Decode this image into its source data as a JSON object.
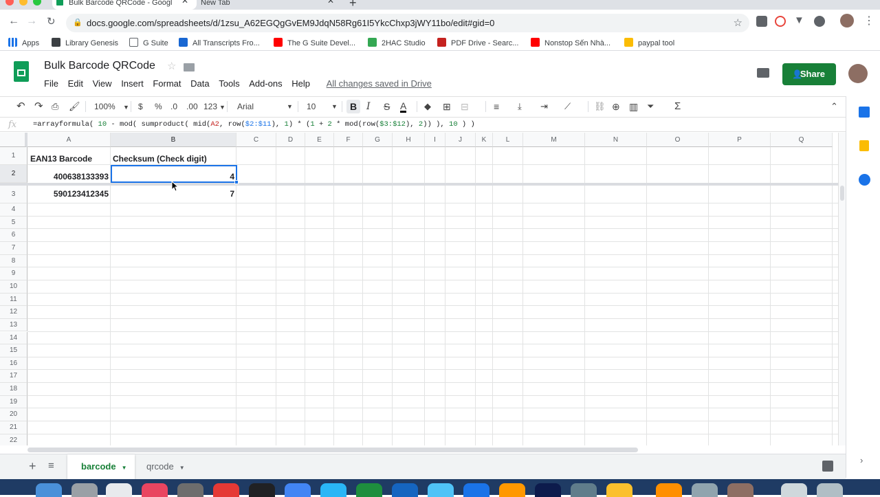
{
  "browser": {
    "tabs": [
      {
        "title": "Bulk Barcode QRCode - Googl"
      },
      {
        "title": "New Tab"
      }
    ],
    "url": "docs.google.com/spreadsheets/d/1zsu_A62EGQgGvEM9JdqN58Rg61I5YkcChxp3jWY11bo/edit#gid=0",
    "bookmarks": [
      "Apps",
      "Library Genesis",
      "G Suite",
      "All Transcripts Fro...",
      "The G Suite Devel...",
      "2HAC Studio",
      "PDF Drive - Searc...",
      "Nonstop Sến Nhà...",
      "paypal tool"
    ]
  },
  "sheets": {
    "title": "Bulk Barcode QRCode",
    "menu": [
      "File",
      "Edit",
      "View",
      "Insert",
      "Format",
      "Data",
      "Tools",
      "Add-ons",
      "Help"
    ],
    "saved_status": "All changes saved in Drive",
    "share_label": "Share",
    "toolbar": {
      "zoom": "100%",
      "currency": "$",
      "percent": "%",
      "dec_less": ".0",
      "dec_more": ".00",
      "number_format": "123",
      "font": "Arial",
      "font_size": "10",
      "bold": "B",
      "italic": "I",
      "strike": "S",
      "text_color": "A"
    },
    "formula": {
      "fx": "fx",
      "parts": [
        {
          "t": "=arrayformula( ",
          "c": ""
        },
        {
          "t": "10",
          "c": "num"
        },
        {
          "t": " - mod( sumproduct( mid(",
          "c": ""
        },
        {
          "t": "A2",
          "c": "ref1"
        },
        {
          "t": ", row(",
          "c": ""
        },
        {
          "t": "$2:$11",
          "c": "ref2"
        },
        {
          "t": "), ",
          "c": ""
        },
        {
          "t": "1",
          "c": "num"
        },
        {
          "t": ") * (",
          "c": ""
        },
        {
          "t": "1",
          "c": "num"
        },
        {
          "t": " + ",
          "c": ""
        },
        {
          "t": "2",
          "c": "num"
        },
        {
          "t": " * mod(row(",
          "c": ""
        },
        {
          "t": "$3:$12",
          "c": "ref3"
        },
        {
          "t": "), ",
          "c": ""
        },
        {
          "t": "2",
          "c": "num"
        },
        {
          "t": ")) ), ",
          "c": ""
        },
        {
          "t": "10",
          "c": "num"
        },
        {
          "t": " ) )",
          "c": ""
        }
      ]
    },
    "columns": [
      "A",
      "B",
      "C",
      "D",
      "E",
      "F",
      "G",
      "H",
      "I",
      "J",
      "K",
      "L",
      "M",
      "N",
      "O",
      "P",
      "Q"
    ],
    "rows": [
      "1",
      "2",
      "3",
      "4",
      "5",
      "6",
      "7",
      "8",
      "9",
      "10",
      "11",
      "12",
      "13",
      "14",
      "15",
      "16",
      "17",
      "18",
      "19",
      "20",
      "21",
      "22"
    ],
    "cells": {
      "A1": "EAN13 Barcode",
      "B1": "Checksum (Check digit)",
      "A2": "400638133393",
      "B2": "4",
      "A3": "590123412345",
      "B3": "7"
    },
    "sheet_tabs": [
      "barcode",
      "qrcode"
    ]
  },
  "colors": {
    "sheets_green": "#188038",
    "selection_blue": "#1a73e8",
    "dock_blue": "#1f3b64"
  }
}
